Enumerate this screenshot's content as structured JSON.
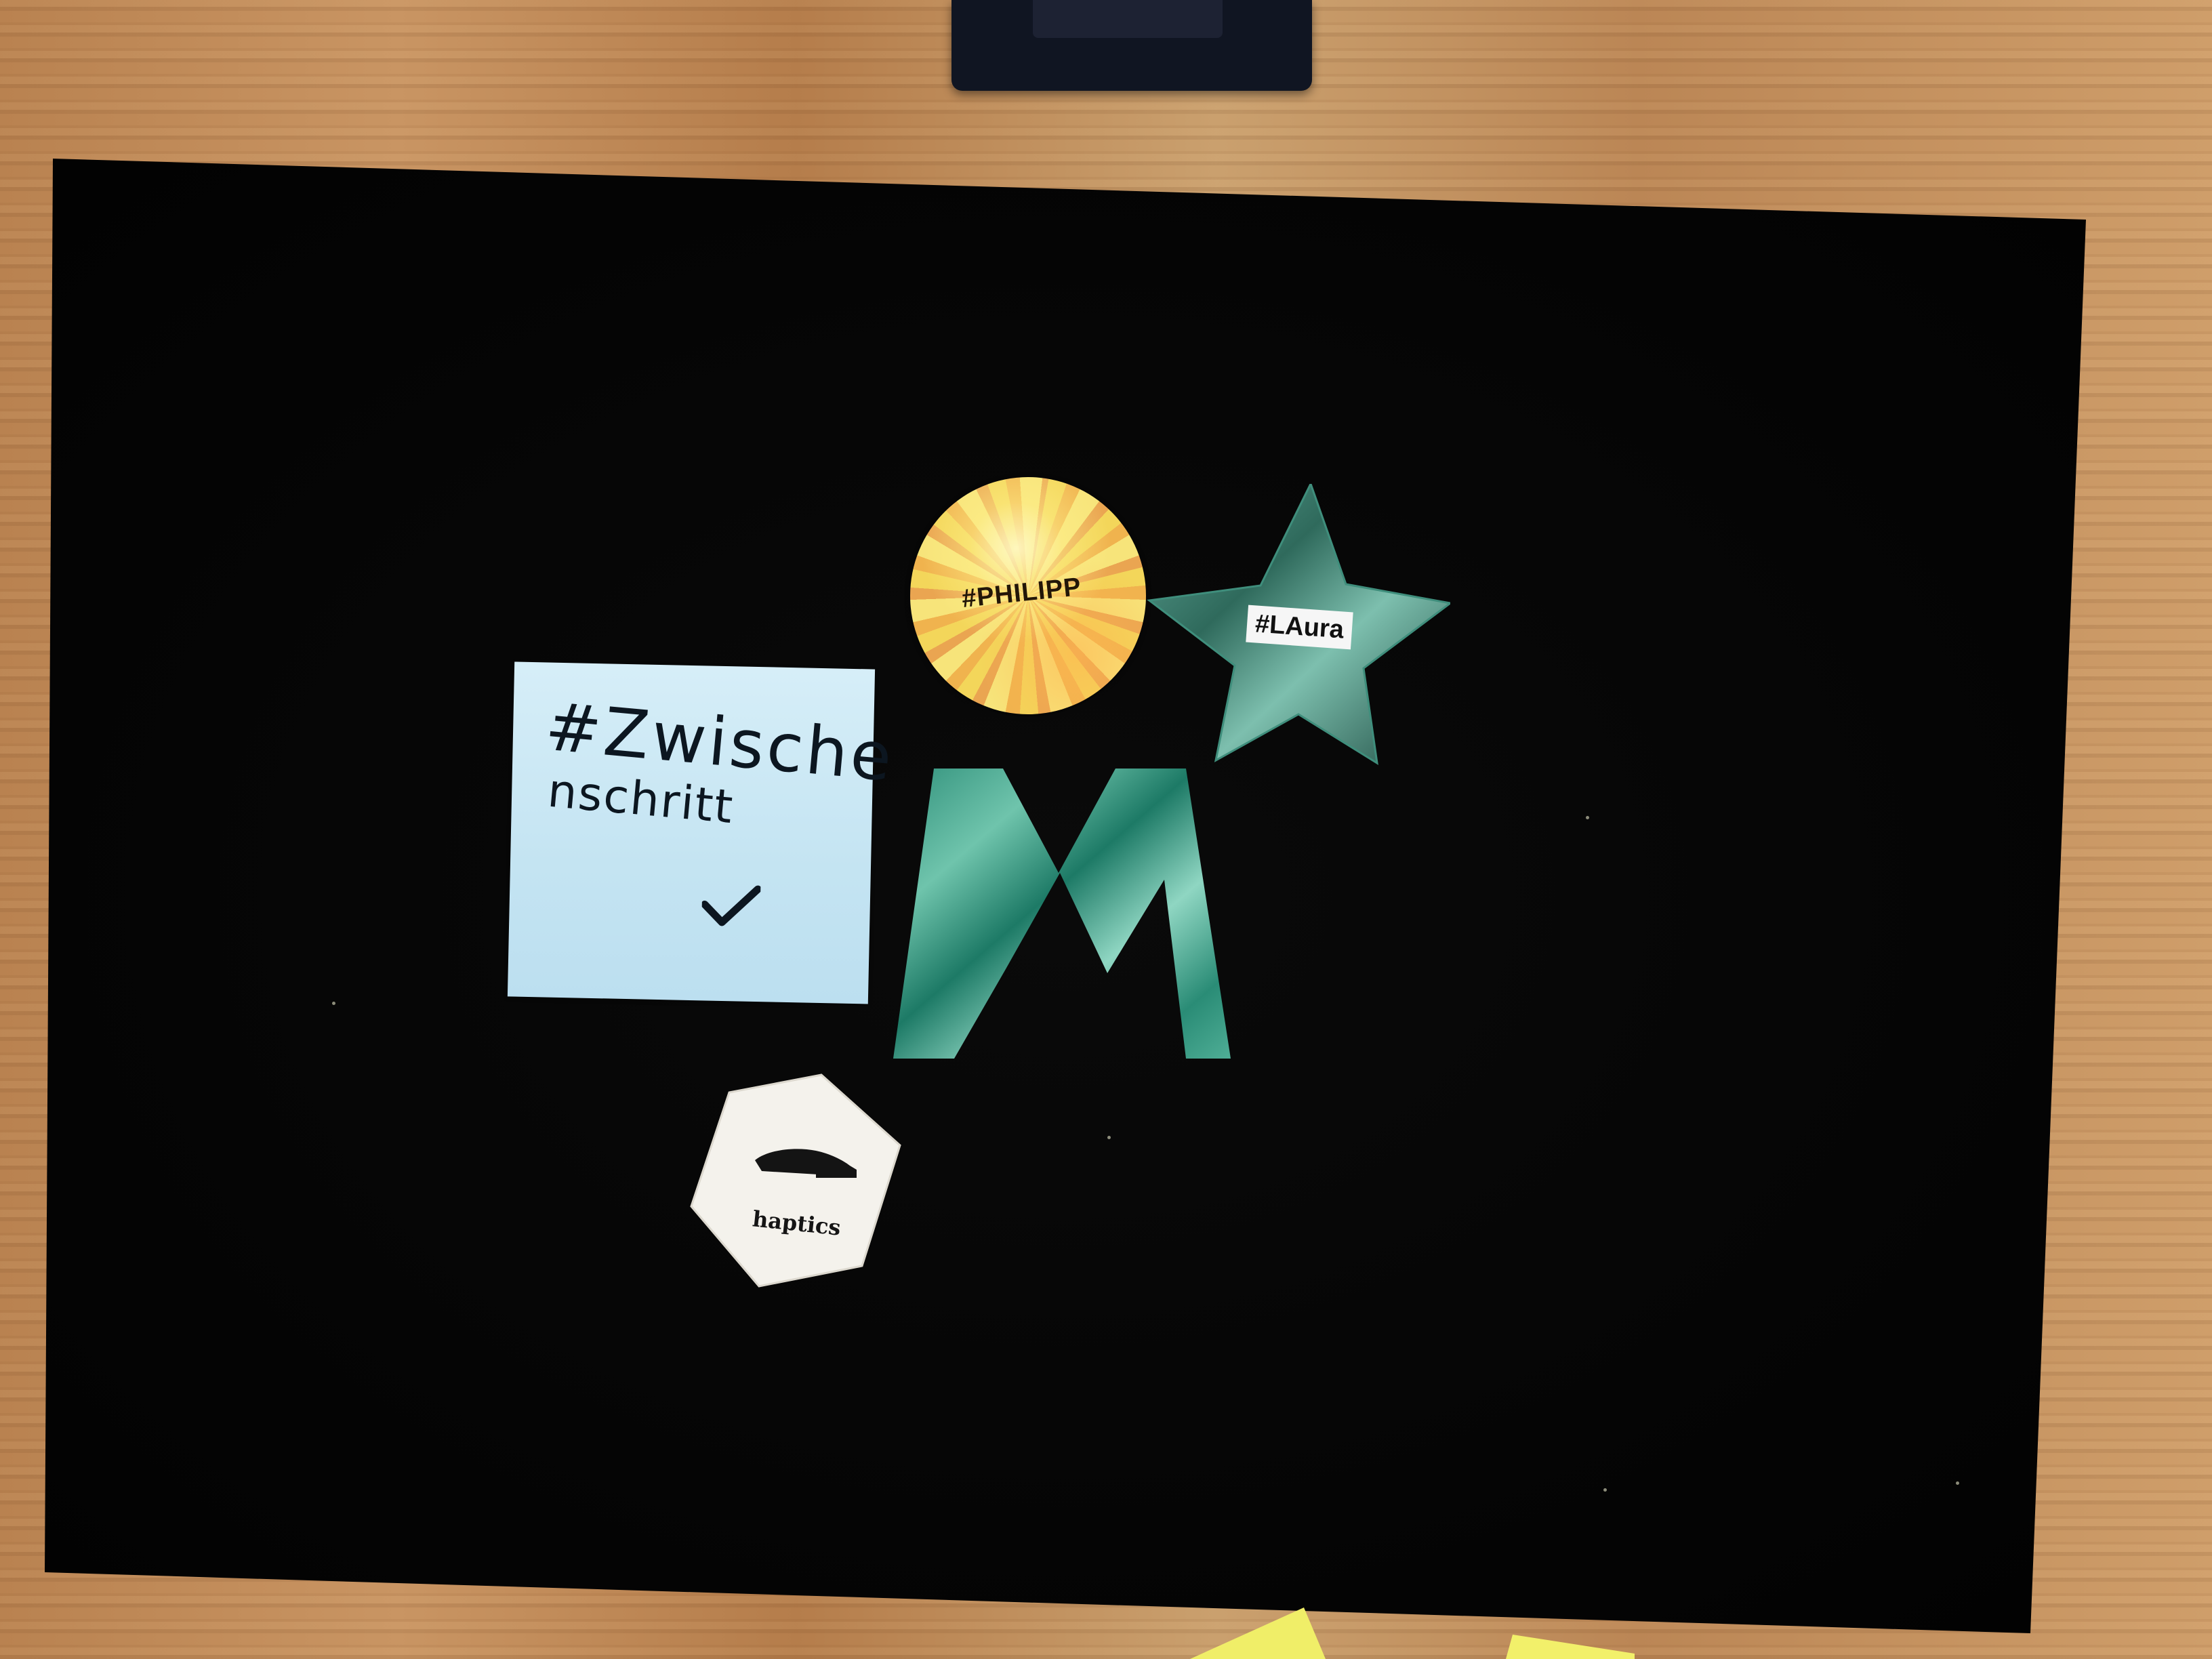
{
  "scene": {
    "background": "wooden-table",
    "board_color": "#050505"
  },
  "sticky_note": {
    "line1": "#Zwische",
    "line2": "nschritt",
    "mark": "check-mark-icon",
    "color": "#c8e6f4"
  },
  "disc": {
    "label": "#PHILIPP",
    "color": "#f2c35a"
  },
  "star": {
    "label": "#LAura",
    "color": "#2f6a5c"
  },
  "letter_m": {
    "color": "#3fa08a"
  },
  "hexagon": {
    "icon": "hand-icon",
    "label": "haptics",
    "color": "#f4f2ec"
  },
  "yellow_notes": {
    "color": "#f2f06a"
  }
}
